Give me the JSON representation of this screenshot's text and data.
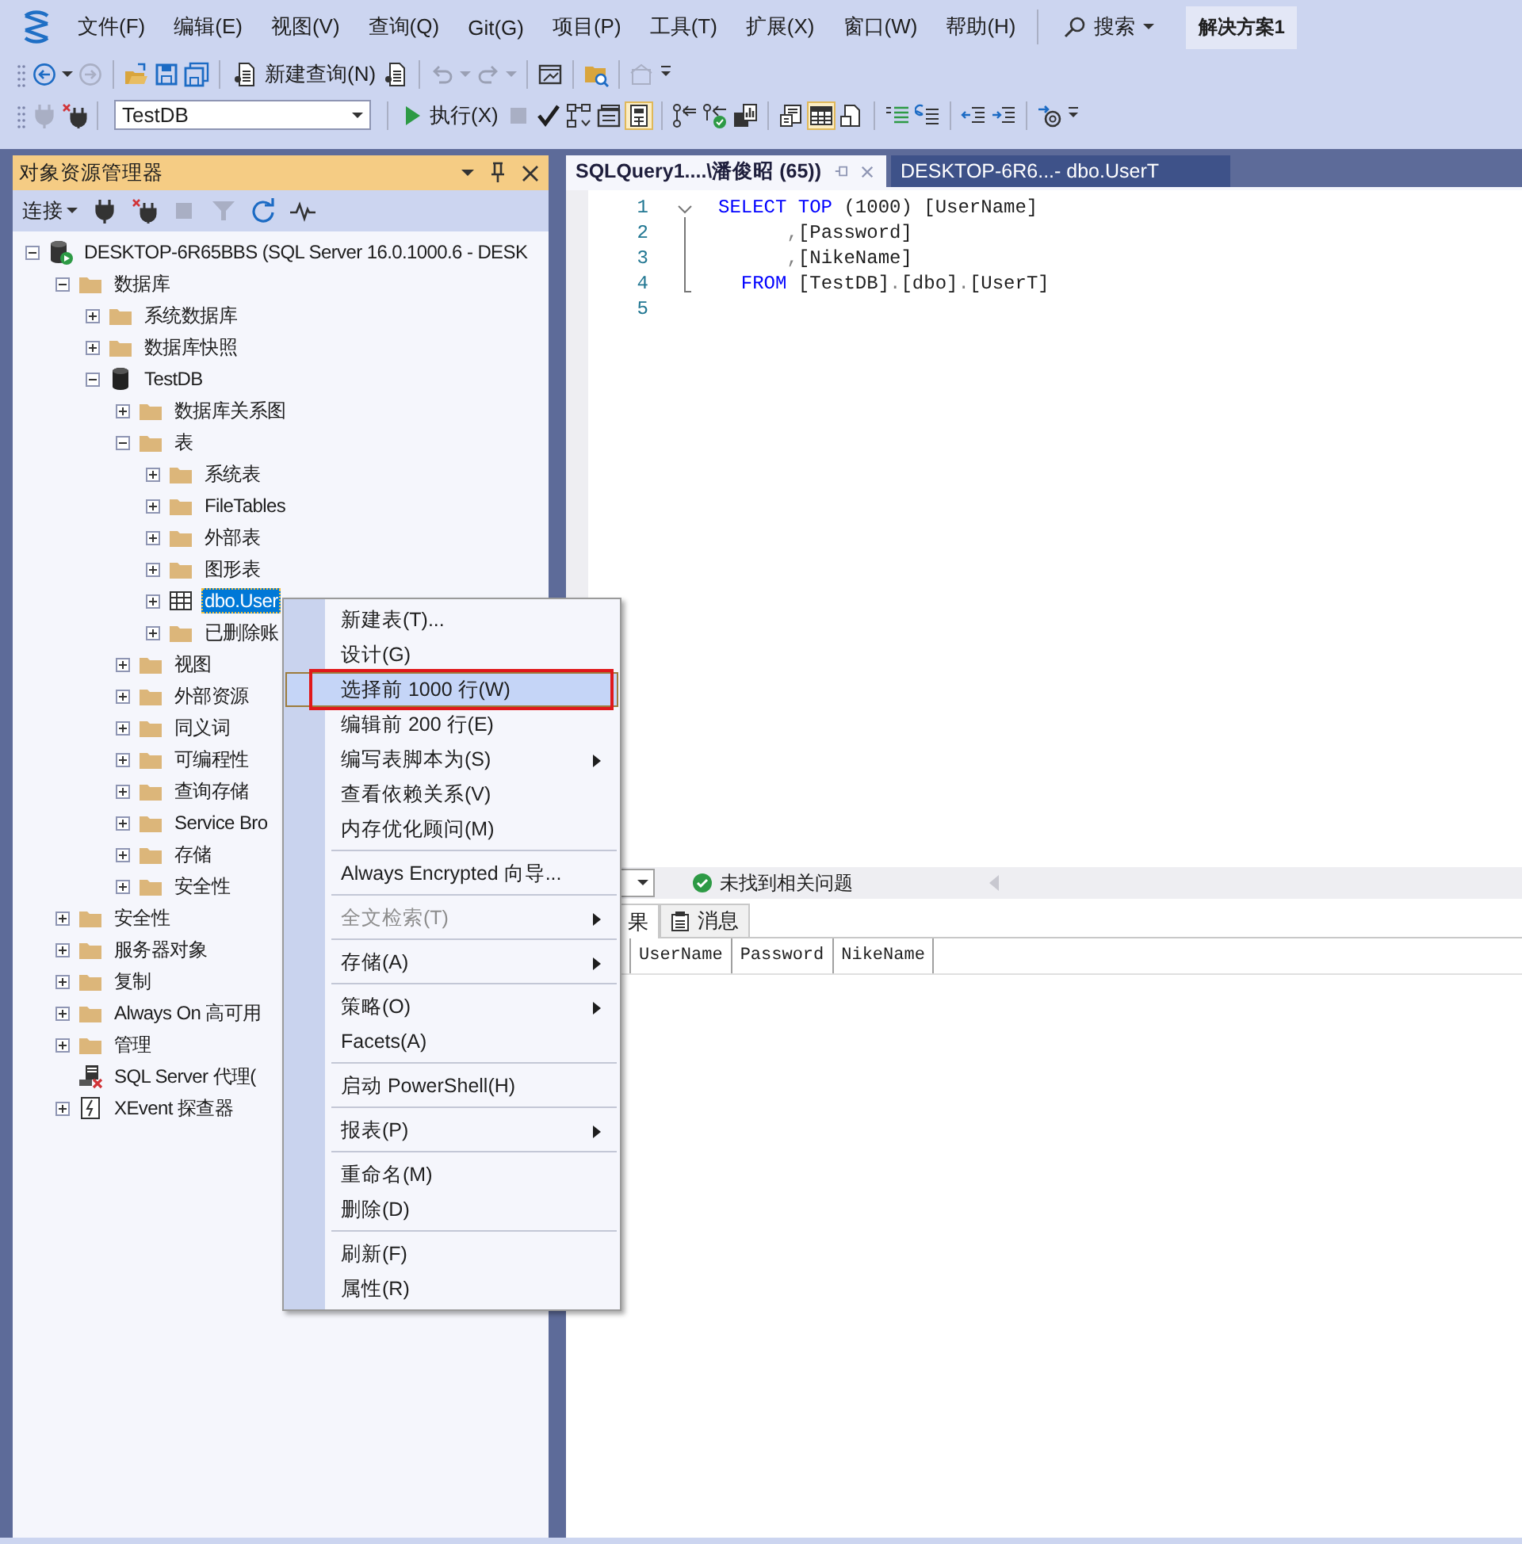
{
  "menu_bar": {
    "items": [
      "文件(F)",
      "编辑(E)",
      "视图(V)",
      "查询(Q)",
      "Git(G)",
      "项目(P)",
      "工具(T)",
      "扩展(X)",
      "窗口(W)",
      "帮助(H)"
    ],
    "search": "搜索",
    "solution": "解决方案1"
  },
  "toolbar": {
    "new_query": "新建查询(N)",
    "database": "TestDB",
    "execute": "执行(X)"
  },
  "object_explorer": {
    "title": "对象资源管理器",
    "connect": "连接",
    "tree": [
      {
        "label": "DESKTOP-6R65BBS (SQL Server 16.0.1000.6 - DESK",
        "kind": "server",
        "expanded": true,
        "selected": false,
        "children": [
          {
            "label": "数据库",
            "kind": "folder",
            "expanded": true,
            "selected": false,
            "children": [
              {
                "label": "系统数据库",
                "kind": "folder",
                "expanded": false,
                "selected": false
              },
              {
                "label": "数据库快照",
                "kind": "folder",
                "expanded": false,
                "selected": false
              },
              {
                "label": "TestDB",
                "kind": "database",
                "expanded": true,
                "selected": false,
                "children": [
                  {
                    "label": "数据库关系图",
                    "kind": "folder",
                    "expanded": false,
                    "selected": false
                  },
                  {
                    "label": "表",
                    "kind": "folder",
                    "expanded": true,
                    "selected": false,
                    "children": [
                      {
                        "label": "系统表",
                        "kind": "folder",
                        "expanded": false,
                        "selected": false
                      },
                      {
                        "label": "FileTables",
                        "kind": "folder",
                        "expanded": false,
                        "selected": false
                      },
                      {
                        "label": "外部表",
                        "kind": "folder",
                        "expanded": false,
                        "selected": false
                      },
                      {
                        "label": "图形表",
                        "kind": "folder",
                        "expanded": false,
                        "selected": false
                      },
                      {
                        "label": "dbo.User",
                        "kind": "table",
                        "expanded": false,
                        "selected": true
                      },
                      {
                        "label": "已删除账",
                        "kind": "folder",
                        "expanded": false,
                        "selected": false
                      }
                    ]
                  },
                  {
                    "label": "视图",
                    "kind": "folder",
                    "expanded": false,
                    "selected": false
                  },
                  {
                    "label": "外部资源",
                    "kind": "folder",
                    "expanded": false,
                    "selected": false
                  },
                  {
                    "label": "同义词",
                    "kind": "folder",
                    "expanded": false,
                    "selected": false
                  },
                  {
                    "label": "可编程性",
                    "kind": "folder",
                    "expanded": false,
                    "selected": false
                  },
                  {
                    "label": "查询存储",
                    "kind": "folder",
                    "expanded": false,
                    "selected": false
                  },
                  {
                    "label": "Service Bro",
                    "kind": "folder",
                    "expanded": false,
                    "selected": false
                  },
                  {
                    "label": "存储",
                    "kind": "folder",
                    "expanded": false,
                    "selected": false
                  },
                  {
                    "label": "安全性",
                    "kind": "folder",
                    "expanded": false,
                    "selected": false
                  }
                ]
              }
            ]
          },
          {
            "label": "安全性",
            "kind": "folder",
            "expanded": false,
            "selected": false
          },
          {
            "label": "服务器对象",
            "kind": "folder",
            "expanded": false,
            "selected": false
          },
          {
            "label": "复制",
            "kind": "folder",
            "expanded": false,
            "selected": false
          },
          {
            "label": "Always On 高可用",
            "kind": "folder",
            "expanded": false,
            "selected": false
          },
          {
            "label": "管理",
            "kind": "folder",
            "expanded": false,
            "selected": false
          },
          {
            "label": "SQL Server 代理(",
            "kind": "agent",
            "selected": false
          },
          {
            "label": "XEvent 探查器",
            "kind": "xevent",
            "expanded": false,
            "selected": false
          }
        ]
      }
    ]
  },
  "editor": {
    "tabs": [
      {
        "label": "SQLQuery1....\\潘俊昭 (65))",
        "selected": true
      },
      {
        "label": "DESKTOP-6R6...- dbo.UserT",
        "selected": false
      }
    ],
    "lines": [
      {
        "number": "1",
        "tokens": [
          {
            "kind": "keyword",
            "text": "SELECT TOP"
          },
          {
            "kind": "plain",
            "text": " (1000) [UserName]"
          }
        ]
      },
      {
        "number": "2",
        "tokens": [
          {
            "kind": "punct",
            "text": "      ,"
          },
          {
            "kind": "plain",
            "text": "[Password]"
          }
        ]
      },
      {
        "number": "3",
        "tokens": [
          {
            "kind": "punct",
            "text": "      ,"
          },
          {
            "kind": "plain",
            "text": "[NikeName]"
          }
        ]
      },
      {
        "number": "4",
        "tokens": [
          {
            "kind": "keyword",
            "text": "  FROM"
          },
          {
            "kind": "plain",
            "text": " [TestDB]"
          },
          {
            "kind": "punct",
            "text": "."
          },
          {
            "kind": "plain",
            "text": "[dbo]"
          },
          {
            "kind": "punct",
            "text": "."
          },
          {
            "kind": "plain",
            "text": "[UserT]"
          }
        ]
      },
      {
        "number": "5"
      }
    ]
  },
  "results": {
    "status": "未找到相关问题",
    "tabs": [
      {
        "label": "果",
        "selected": true
      },
      {
        "label": "消息",
        "selected": false
      }
    ],
    "columns": [
      "UserName",
      "Password",
      "NikeName"
    ]
  },
  "context_menu": {
    "items": [
      {
        "kind": "item",
        "label": "新建表(T)...",
        "selected": false
      },
      {
        "kind": "item",
        "label": "设计(G)",
        "selected": false
      },
      {
        "kind": "item",
        "label": "选择前 1000 行(W)",
        "selected": true,
        "annotated": true
      },
      {
        "kind": "item",
        "label": "编辑前 200 行(E)",
        "selected": false
      },
      {
        "kind": "item",
        "label": "编写表脚本为(S)",
        "selected": false,
        "submenu": true
      },
      {
        "kind": "item",
        "label": "查看依赖关系(V)",
        "selected": false
      },
      {
        "kind": "item",
        "label": "内存优化顾问(M)",
        "selected": false
      },
      {
        "kind": "separator"
      },
      {
        "kind": "item",
        "label": "Always Encrypted 向导...",
        "selected": false
      },
      {
        "kind": "separator"
      },
      {
        "kind": "item",
        "label": "全文检索(T)",
        "selected": false,
        "submenu": true,
        "disabled": true
      },
      {
        "kind": "separator"
      },
      {
        "kind": "item",
        "label": "存储(A)",
        "selected": false,
        "submenu": true
      },
      {
        "kind": "separator"
      },
      {
        "kind": "item",
        "label": "策略(O)",
        "selected": false,
        "submenu": true
      },
      {
        "kind": "item",
        "label": "Facets(A)",
        "selected": false
      },
      {
        "kind": "separator"
      },
      {
        "kind": "item",
        "label": "启动 PowerShell(H)",
        "selected": false
      },
      {
        "kind": "separator"
      },
      {
        "kind": "item",
        "label": "报表(P)",
        "selected": false,
        "submenu": true
      },
      {
        "kind": "separator"
      },
      {
        "kind": "item",
        "label": "重命名(M)",
        "selected": false
      },
      {
        "kind": "item",
        "label": "删除(D)",
        "selected": false
      },
      {
        "kind": "separator"
      },
      {
        "kind": "item",
        "label": "刷新(F)",
        "selected": false
      },
      {
        "kind": "item",
        "label": "属性(R)",
        "selected": false
      }
    ]
  }
}
